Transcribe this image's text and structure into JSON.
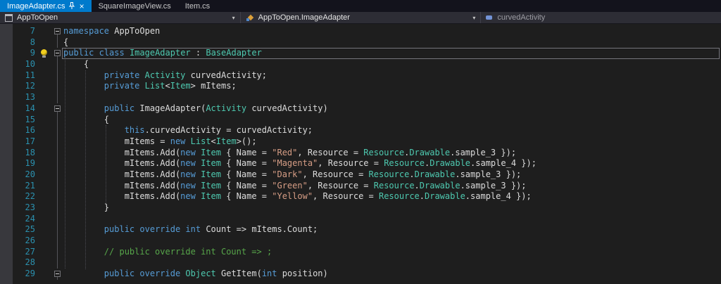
{
  "colors": {
    "accent": "#007ACC",
    "editorBg": "#1E1E1E",
    "lineNumber": "#2B91AF",
    "keyword": "#569CD6",
    "type": "#4EC9B0",
    "plain": "#DCDCDC",
    "string": "#D69D85",
    "comment": "#57A64A"
  },
  "tabs": [
    {
      "label": "ImageAdapter.cs",
      "active": true,
      "pinned": true,
      "closable": true
    },
    {
      "label": "SquareImageView.cs",
      "active": false
    },
    {
      "label": "Item.cs",
      "active": false
    }
  ],
  "navbar": {
    "project": "AppToOpen",
    "type": "AppToOpen.ImageAdapter",
    "member": "curvedActivity"
  },
  "editor": {
    "lines": [
      {
        "n": 7,
        "fold": "box",
        "segs": [
          [
            "namespace",
            "keyword"
          ],
          [
            " AppToOpen",
            "plain"
          ]
        ]
      },
      {
        "n": 8,
        "fold": "line",
        "segs": [
          [
            "{",
            "plain"
          ]
        ]
      },
      {
        "n": 9,
        "fold": "box",
        "bulb": true,
        "caret": true,
        "segs": [
          [
            "public",
            "keyword"
          ],
          [
            " ",
            "plain"
          ],
          [
            "class",
            "keyword"
          ],
          [
            " ",
            "plain"
          ],
          [
            "ImageAdapter",
            "type"
          ],
          [
            " : ",
            "plain"
          ],
          [
            "BaseAdapter",
            "type"
          ]
        ]
      },
      {
        "n": 10,
        "fold": "line",
        "segs": [
          [
            "    {",
            "plain"
          ]
        ]
      },
      {
        "n": 11,
        "fold": "line",
        "segs": [
          [
            "        ",
            "plain"
          ],
          [
            "private",
            "keyword"
          ],
          [
            " ",
            "plain"
          ],
          [
            "Activity",
            "type"
          ],
          [
            " curvedActivity;",
            "plain"
          ]
        ]
      },
      {
        "n": 12,
        "fold": "line",
        "segs": [
          [
            "        ",
            "plain"
          ],
          [
            "private",
            "keyword"
          ],
          [
            " ",
            "plain"
          ],
          [
            "List",
            "type"
          ],
          [
            "<",
            "plain"
          ],
          [
            "Item",
            "type"
          ],
          [
            "> mItems;",
            "plain"
          ]
        ]
      },
      {
        "n": 13,
        "fold": "line",
        "segs": []
      },
      {
        "n": 14,
        "fold": "box",
        "segs": [
          [
            "        ",
            "plain"
          ],
          [
            "public",
            "keyword"
          ],
          [
            " ImageAdapter(",
            "plain"
          ],
          [
            "Activity",
            "type"
          ],
          [
            " curvedActivity)",
            "plain"
          ]
        ]
      },
      {
        "n": 15,
        "fold": "line",
        "segs": [
          [
            "        {",
            "plain"
          ]
        ]
      },
      {
        "n": 16,
        "fold": "line",
        "segs": [
          [
            "            ",
            "plain"
          ],
          [
            "this",
            "keyword"
          ],
          [
            ".curvedActivity = curvedActivity;",
            "plain"
          ]
        ]
      },
      {
        "n": 17,
        "fold": "line",
        "segs": [
          [
            "            mItems = ",
            "plain"
          ],
          [
            "new",
            "keyword"
          ],
          [
            " ",
            "plain"
          ],
          [
            "List",
            "type"
          ],
          [
            "<",
            "plain"
          ],
          [
            "Item",
            "type"
          ],
          [
            ">();",
            "plain"
          ]
        ]
      },
      {
        "n": 18,
        "fold": "line",
        "segs": [
          [
            "            mItems.Add(",
            "plain"
          ],
          [
            "new",
            "keyword"
          ],
          [
            " ",
            "plain"
          ],
          [
            "Item",
            "type"
          ],
          [
            " { Name = ",
            "plain"
          ],
          [
            "\"Red\"",
            "string"
          ],
          [
            ", Resource = ",
            "plain"
          ],
          [
            "Resource",
            "type"
          ],
          [
            ".",
            "plain"
          ],
          [
            "Drawable",
            "type"
          ],
          [
            ".sample_3 });",
            "plain"
          ]
        ]
      },
      {
        "n": 19,
        "fold": "line",
        "segs": [
          [
            "            mItems.Add(",
            "plain"
          ],
          [
            "new",
            "keyword"
          ],
          [
            " ",
            "plain"
          ],
          [
            "Item",
            "type"
          ],
          [
            " { Name = ",
            "plain"
          ],
          [
            "\"Magenta\"",
            "string"
          ],
          [
            ", Resource = ",
            "plain"
          ],
          [
            "Resource",
            "type"
          ],
          [
            ".",
            "plain"
          ],
          [
            "Drawable",
            "type"
          ],
          [
            ".sample_4 });",
            "plain"
          ]
        ]
      },
      {
        "n": 20,
        "fold": "line",
        "segs": [
          [
            "            mItems.Add(",
            "plain"
          ],
          [
            "new",
            "keyword"
          ],
          [
            " ",
            "plain"
          ],
          [
            "Item",
            "type"
          ],
          [
            " { Name = ",
            "plain"
          ],
          [
            "\"Dark\"",
            "string"
          ],
          [
            ", Resource = ",
            "plain"
          ],
          [
            "Resource",
            "type"
          ],
          [
            ".",
            "plain"
          ],
          [
            "Drawable",
            "type"
          ],
          [
            ".sample_3 });",
            "plain"
          ]
        ]
      },
      {
        "n": 21,
        "fold": "line",
        "segs": [
          [
            "            mItems.Add(",
            "plain"
          ],
          [
            "new",
            "keyword"
          ],
          [
            " ",
            "plain"
          ],
          [
            "Item",
            "type"
          ],
          [
            " { Name = ",
            "plain"
          ],
          [
            "\"Green\"",
            "string"
          ],
          [
            ", Resource = ",
            "plain"
          ],
          [
            "Resource",
            "type"
          ],
          [
            ".",
            "plain"
          ],
          [
            "Drawable",
            "type"
          ],
          [
            ".sample_3 });",
            "plain"
          ]
        ]
      },
      {
        "n": 22,
        "fold": "line",
        "segs": [
          [
            "            mItems.Add(",
            "plain"
          ],
          [
            "new",
            "keyword"
          ],
          [
            " ",
            "plain"
          ],
          [
            "Item",
            "type"
          ],
          [
            " { Name = ",
            "plain"
          ],
          [
            "\"Yellow\"",
            "string"
          ],
          [
            ", Resource = ",
            "plain"
          ],
          [
            "Resource",
            "type"
          ],
          [
            ".",
            "plain"
          ],
          [
            "Drawable",
            "type"
          ],
          [
            ".sample_4 });",
            "plain"
          ]
        ]
      },
      {
        "n": 23,
        "fold": "line",
        "segs": [
          [
            "        }",
            "plain"
          ]
        ]
      },
      {
        "n": 24,
        "fold": "line",
        "segs": []
      },
      {
        "n": 25,
        "fold": "line",
        "segs": [
          [
            "        ",
            "plain"
          ],
          [
            "public",
            "keyword"
          ],
          [
            " ",
            "plain"
          ],
          [
            "override",
            "keyword"
          ],
          [
            " ",
            "plain"
          ],
          [
            "int",
            "keyword"
          ],
          [
            " Count => mItems.Count;",
            "plain"
          ]
        ]
      },
      {
        "n": 26,
        "fold": "line",
        "segs": []
      },
      {
        "n": 27,
        "fold": "line",
        "segs": [
          [
            "        // public override int Count => ;",
            "comment"
          ]
        ]
      },
      {
        "n": 28,
        "fold": "line",
        "segs": []
      },
      {
        "n": 29,
        "fold": "box",
        "segs": [
          [
            "        ",
            "plain"
          ],
          [
            "public",
            "keyword"
          ],
          [
            " ",
            "plain"
          ],
          [
            "override",
            "keyword"
          ],
          [
            " ",
            "plain"
          ],
          [
            "Object",
            "type"
          ],
          [
            " GetItem(",
            "plain"
          ],
          [
            "int",
            "keyword"
          ],
          [
            " position)",
            "plain"
          ]
        ]
      }
    ]
  }
}
